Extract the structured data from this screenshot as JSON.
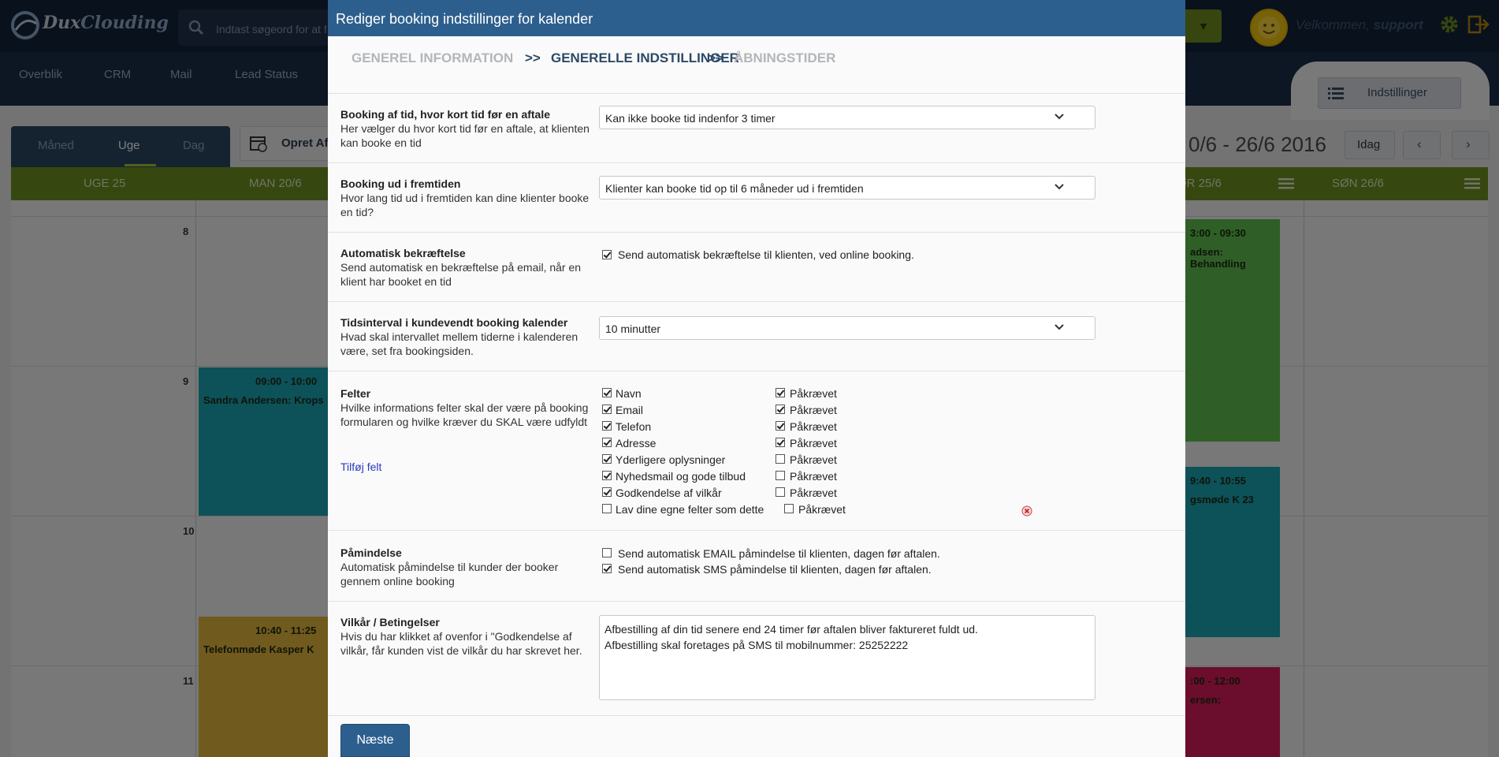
{
  "app": {
    "brand": {
      "part1": "Dux",
      "part2": "Clouding"
    },
    "search_placeholder": "Indtast søgeord for at fi",
    "welcome_prefix": "Velkommen, ",
    "welcome_user": "support",
    "nav": [
      "Overblik",
      "CRM",
      "Mail",
      "Lead Status"
    ],
    "settings_label": "Indstillinger",
    "view_tabs": [
      "Måned",
      "Uge",
      "Dag"
    ],
    "active_view": "Uge",
    "create_label": "Opret Af",
    "date_range": "0/6 - 26/6 2016",
    "today_label": "Idag",
    "prev_label": "‹",
    "next_label": "›",
    "week_label": "UGE 25",
    "days": [
      "MAN 20/6",
      "ØR 25/6",
      "SØN 26/6"
    ],
    "hours": [
      "8",
      "9",
      "10",
      "11"
    ],
    "events": [
      {
        "time": "09:00 - 10:00",
        "name": "Sandra Andersen: Krops",
        "color": "#1ba3b3"
      },
      {
        "time": "10:40 - 11:25",
        "name": "Telefonmøde Kasper K",
        "color": "#e3b53c"
      },
      {
        "time": "3:00 - 09:30",
        "name": "adsen: Behandling",
        "color": "#5fbe4e"
      },
      {
        "time": "9:40 - 10:55",
        "name": "gsmøde K 23",
        "color": "#1ba3b3"
      },
      {
        "time": ":00 - 12:00",
        "name": "ersen:",
        "color": "#d61b5a"
      }
    ]
  },
  "modal": {
    "title": "Rediger booking indstillinger for kalender",
    "steps": [
      "GENEREL INFORMATION",
      "GENERELLE INDSTILLINGER",
      "ÅBNINGSTIDER"
    ],
    "step_sep": ">>",
    "current_step": 1,
    "rows": {
      "short_notice": {
        "title": "Booking af tid, hvor kort tid før en aftale",
        "desc": "Her vælger du hvor kort tid før en aftale, at klienten kan booke en tid",
        "value": "Kan ikke booke tid indenfor 3 timer"
      },
      "future": {
        "title": "Booking ud i fremtiden",
        "desc": "Hvor lang tid ud i fremtiden kan dine klienter booke en tid?",
        "value": "Klienter kan booke tid op til 6 måneder ud i fremtiden"
      },
      "auto_confirm": {
        "title": "Automatisk bekræftelse",
        "desc": "Send automatisk en bekræftelse på email, når en klient har booket en tid",
        "checkbox_label": "Send automatisk bekræftelse til klienten, ved online booking.",
        "checked": true
      },
      "interval": {
        "title": "Tidsinterval i kundevendt booking kalender",
        "desc": "Hvad skal intervallet mellem tiderne i kalenderen være, set fra bookingsiden.",
        "value": "10 minutter"
      },
      "fields": {
        "title": "Felter",
        "desc": "Hvilke informations felter skal der være på booking formularen og hvilke kræver du SKAL være udfyldt",
        "add_link": "Tilføj felt",
        "required_label": "Påkrævet",
        "items": [
          {
            "label": "Navn",
            "enabled": true,
            "required": true
          },
          {
            "label": "Email",
            "enabled": true,
            "required": true
          },
          {
            "label": "Telefon",
            "enabled": true,
            "required": true
          },
          {
            "label": "Adresse",
            "enabled": true,
            "required": true
          },
          {
            "label": "Yderligere oplysninger",
            "enabled": true,
            "required": false
          },
          {
            "label": "Nyhedsmail og gode tilbud",
            "enabled": true,
            "required": false
          },
          {
            "label": "Godkendelse af vilkår",
            "enabled": true,
            "required": false
          }
        ],
        "custom": {
          "label": "Lav dine egne felter som dette",
          "enabled": false,
          "required": false
        }
      },
      "reminder": {
        "title": "Påmindelse",
        "desc": "Automatisk påmindelse til kunder der booker gennem online booking",
        "email_label": "Send automatisk EMAIL påmindelse til klienten, dagen før aftalen.",
        "email_checked": false,
        "sms_label": "Send automatisk SMS påmindelse til klienten, dagen før aftalen.",
        "sms_checked": true
      },
      "terms": {
        "title": "Vilkår / Betingelser",
        "desc": "Hvis du har klikket af ovenfor i \"Godkendelse af vilkår, får kunden vist de vilkår du har skrevet her.",
        "value": "Afbestilling af din tid senere end 24 timer før aftalen bliver faktureret fuldt ud.\nAfbestilling skal foretages på SMS til mobilnummer: 25252222"
      }
    },
    "next_label": "Næste"
  },
  "colors": {
    "header_blue": "#2d5f8e",
    "calendar_green": "#6d8f20",
    "dark_nav": "#12223a"
  }
}
